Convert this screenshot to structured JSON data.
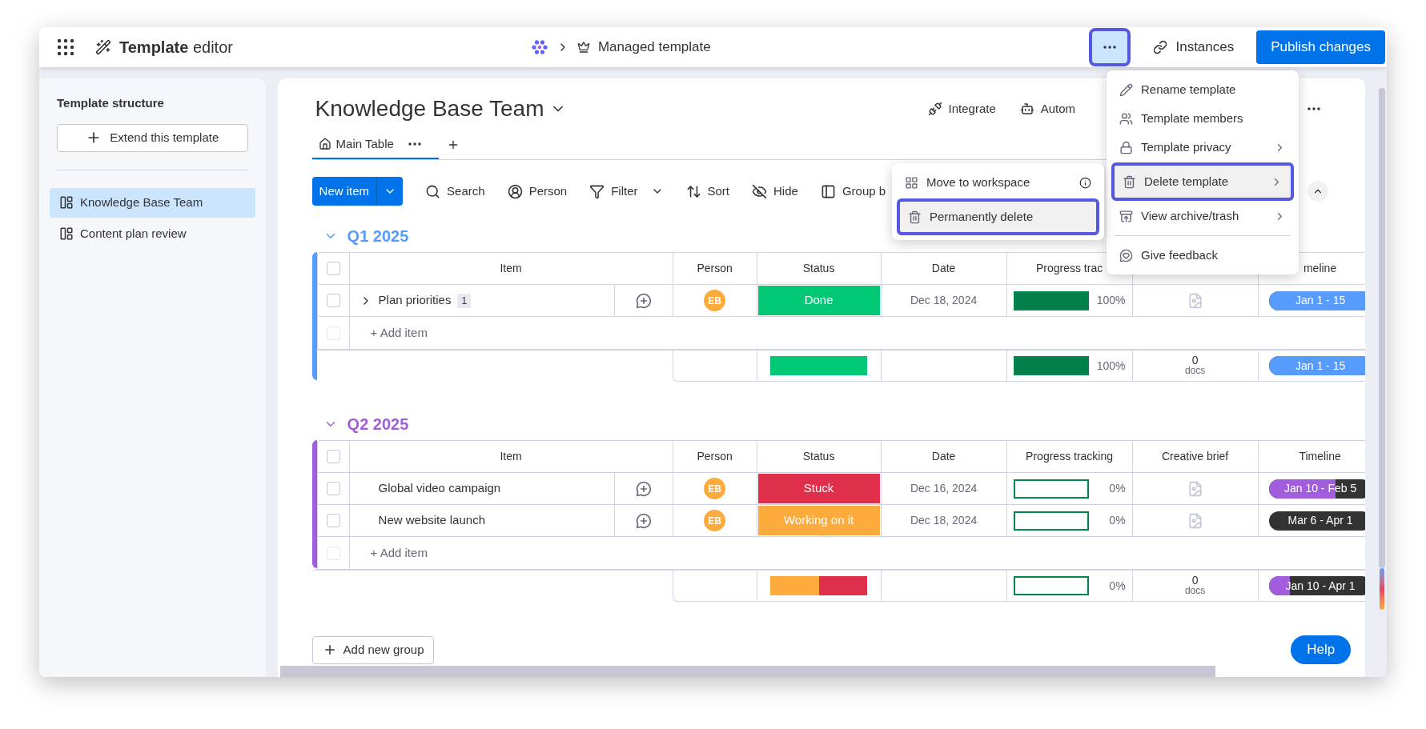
{
  "top_bar": {
    "title_bold": "Template",
    "title_rest": "editor",
    "breadcrumb": "Managed template",
    "more_button": {
      "highlighted": true
    },
    "instances": "Instances",
    "publish": "Publish changes"
  },
  "sidebar": {
    "title": "Template structure",
    "extend_button": "Extend this template",
    "items": [
      {
        "label": "Knowledge Base Team",
        "selected": true
      },
      {
        "label": "Content plan review",
        "selected": false
      }
    ]
  },
  "board": {
    "title": "Knowledge Base Team",
    "header_actions": [
      "Integrate",
      "Autom"
    ],
    "tabs": [
      {
        "label": "Main Table",
        "selected": true
      }
    ],
    "new_item": "New item",
    "toolbar": [
      "Search",
      "Person",
      "Filter",
      "Sort",
      "Hide",
      "Group b"
    ]
  },
  "groups": [
    {
      "title": "Q1 2025",
      "color": "#579bfc",
      "all_checked": false,
      "add_item_checked": false,
      "columns": [
        "Item",
        "Person",
        "Status",
        "Date",
        "Progress trac",
        null,
        "meline"
      ],
      "rows": [
        {
          "item": "Plan priorities",
          "subitems": "1",
          "checked": false,
          "person": "EB",
          "status": {
            "label": "Done",
            "color": "#00c875"
          },
          "date": "Dec 18, 2024",
          "progress": {
            "level": 1,
            "reading": "100%"
          },
          "timeline": {
            "label": "Jan 1 - 15",
            "color": "#579bfc",
            "level": 1
          }
        }
      ],
      "add_item": "+ Add item",
      "summary": {
        "status": [
          {
            "color": "#00c875"
          }
        ],
        "progress": {
          "level": 1,
          "reading": "100%"
        },
        "docs_count": "0",
        "docs_label": "docs",
        "timeline": {
          "label": "Jan 1 - 15",
          "color": "#579bfc",
          "level": 1
        }
      }
    },
    {
      "title": "Q2 2025",
      "color": "#a25ddc",
      "all_checked": false,
      "add_item_checked": false,
      "columns": [
        "Item",
        "Person",
        "Status",
        "Date",
        "Progress tracking",
        "Creative brief",
        "Timeline"
      ],
      "rows": [
        {
          "item": "Global video campaign",
          "checked": false,
          "person": "EB",
          "status": {
            "label": "Stuck",
            "color": "#df2f4a"
          },
          "date": "Dec 16, 2024",
          "progress": {
            "level": 0,
            "reading": "0%"
          },
          "timeline": {
            "label": "Jan 10 - Feb 5",
            "color": "#a25ddc",
            "level": 0.65
          }
        },
        {
          "item": "New website launch",
          "checked": false,
          "person": "EB",
          "status": {
            "label": "Working on it",
            "color": "#fdab3d"
          },
          "date": "Dec 18, 2024",
          "progress": {
            "level": 0,
            "reading": "0%"
          },
          "timeline": {
            "label": "Mar 6 - Apr 1"
          }
        }
      ],
      "add_item": "+ Add item",
      "summary": {
        "status": [
          {
            "color": "#fdab3d"
          },
          {
            "color": "#df2f4a"
          }
        ],
        "progress": {
          "level": 0,
          "reading": "0%"
        },
        "docs_count": "0",
        "docs_label": "docs",
        "timeline": {
          "label": "Jan 10 - Apr 1",
          "color": "#a25ddc",
          "level": 0.2
        }
      }
    }
  ],
  "add_group": "Add new group",
  "help": "Help",
  "menu": [
    {
      "label": "Rename template",
      "submenu": false,
      "highlighted": false
    },
    {
      "label": "Template members",
      "submenu": false,
      "highlighted": false
    },
    {
      "label": "Template privacy",
      "submenu": true,
      "highlighted": false
    },
    {
      "label": "Delete template",
      "submenu": true,
      "highlighted": true
    },
    {
      "label": "View archive/trash",
      "submenu": true,
      "highlighted": false
    },
    {
      "label": "Give feedback",
      "submenu": false,
      "highlighted": false
    }
  ],
  "submenu": [
    {
      "label": "Move to workspace",
      "info": true,
      "highlighted": false
    },
    {
      "label": "Permanently delete",
      "info": false,
      "highlighted": true
    }
  ]
}
